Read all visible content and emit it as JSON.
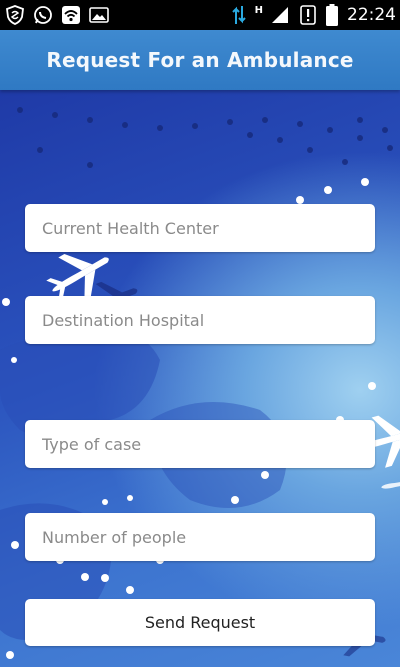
{
  "status_bar": {
    "time": "22:24",
    "network_label": "H",
    "icons": [
      "shield-icon",
      "whatsapp-icon",
      "wifi-icon",
      "image-icon",
      "data-transfer-icon",
      "signal-icon",
      "alert-icon",
      "battery-icon"
    ]
  },
  "app_bar": {
    "title": "Request For an Ambulance",
    "color": "#3a85cc"
  },
  "form": {
    "current_health_center_placeholder": "Current Health Center",
    "destination_hospital_placeholder": "Destination Hospital",
    "type_of_case_placeholder": "Type of case",
    "number_of_people_placeholder": "Number of people",
    "send_request_label": "Send Request"
  }
}
